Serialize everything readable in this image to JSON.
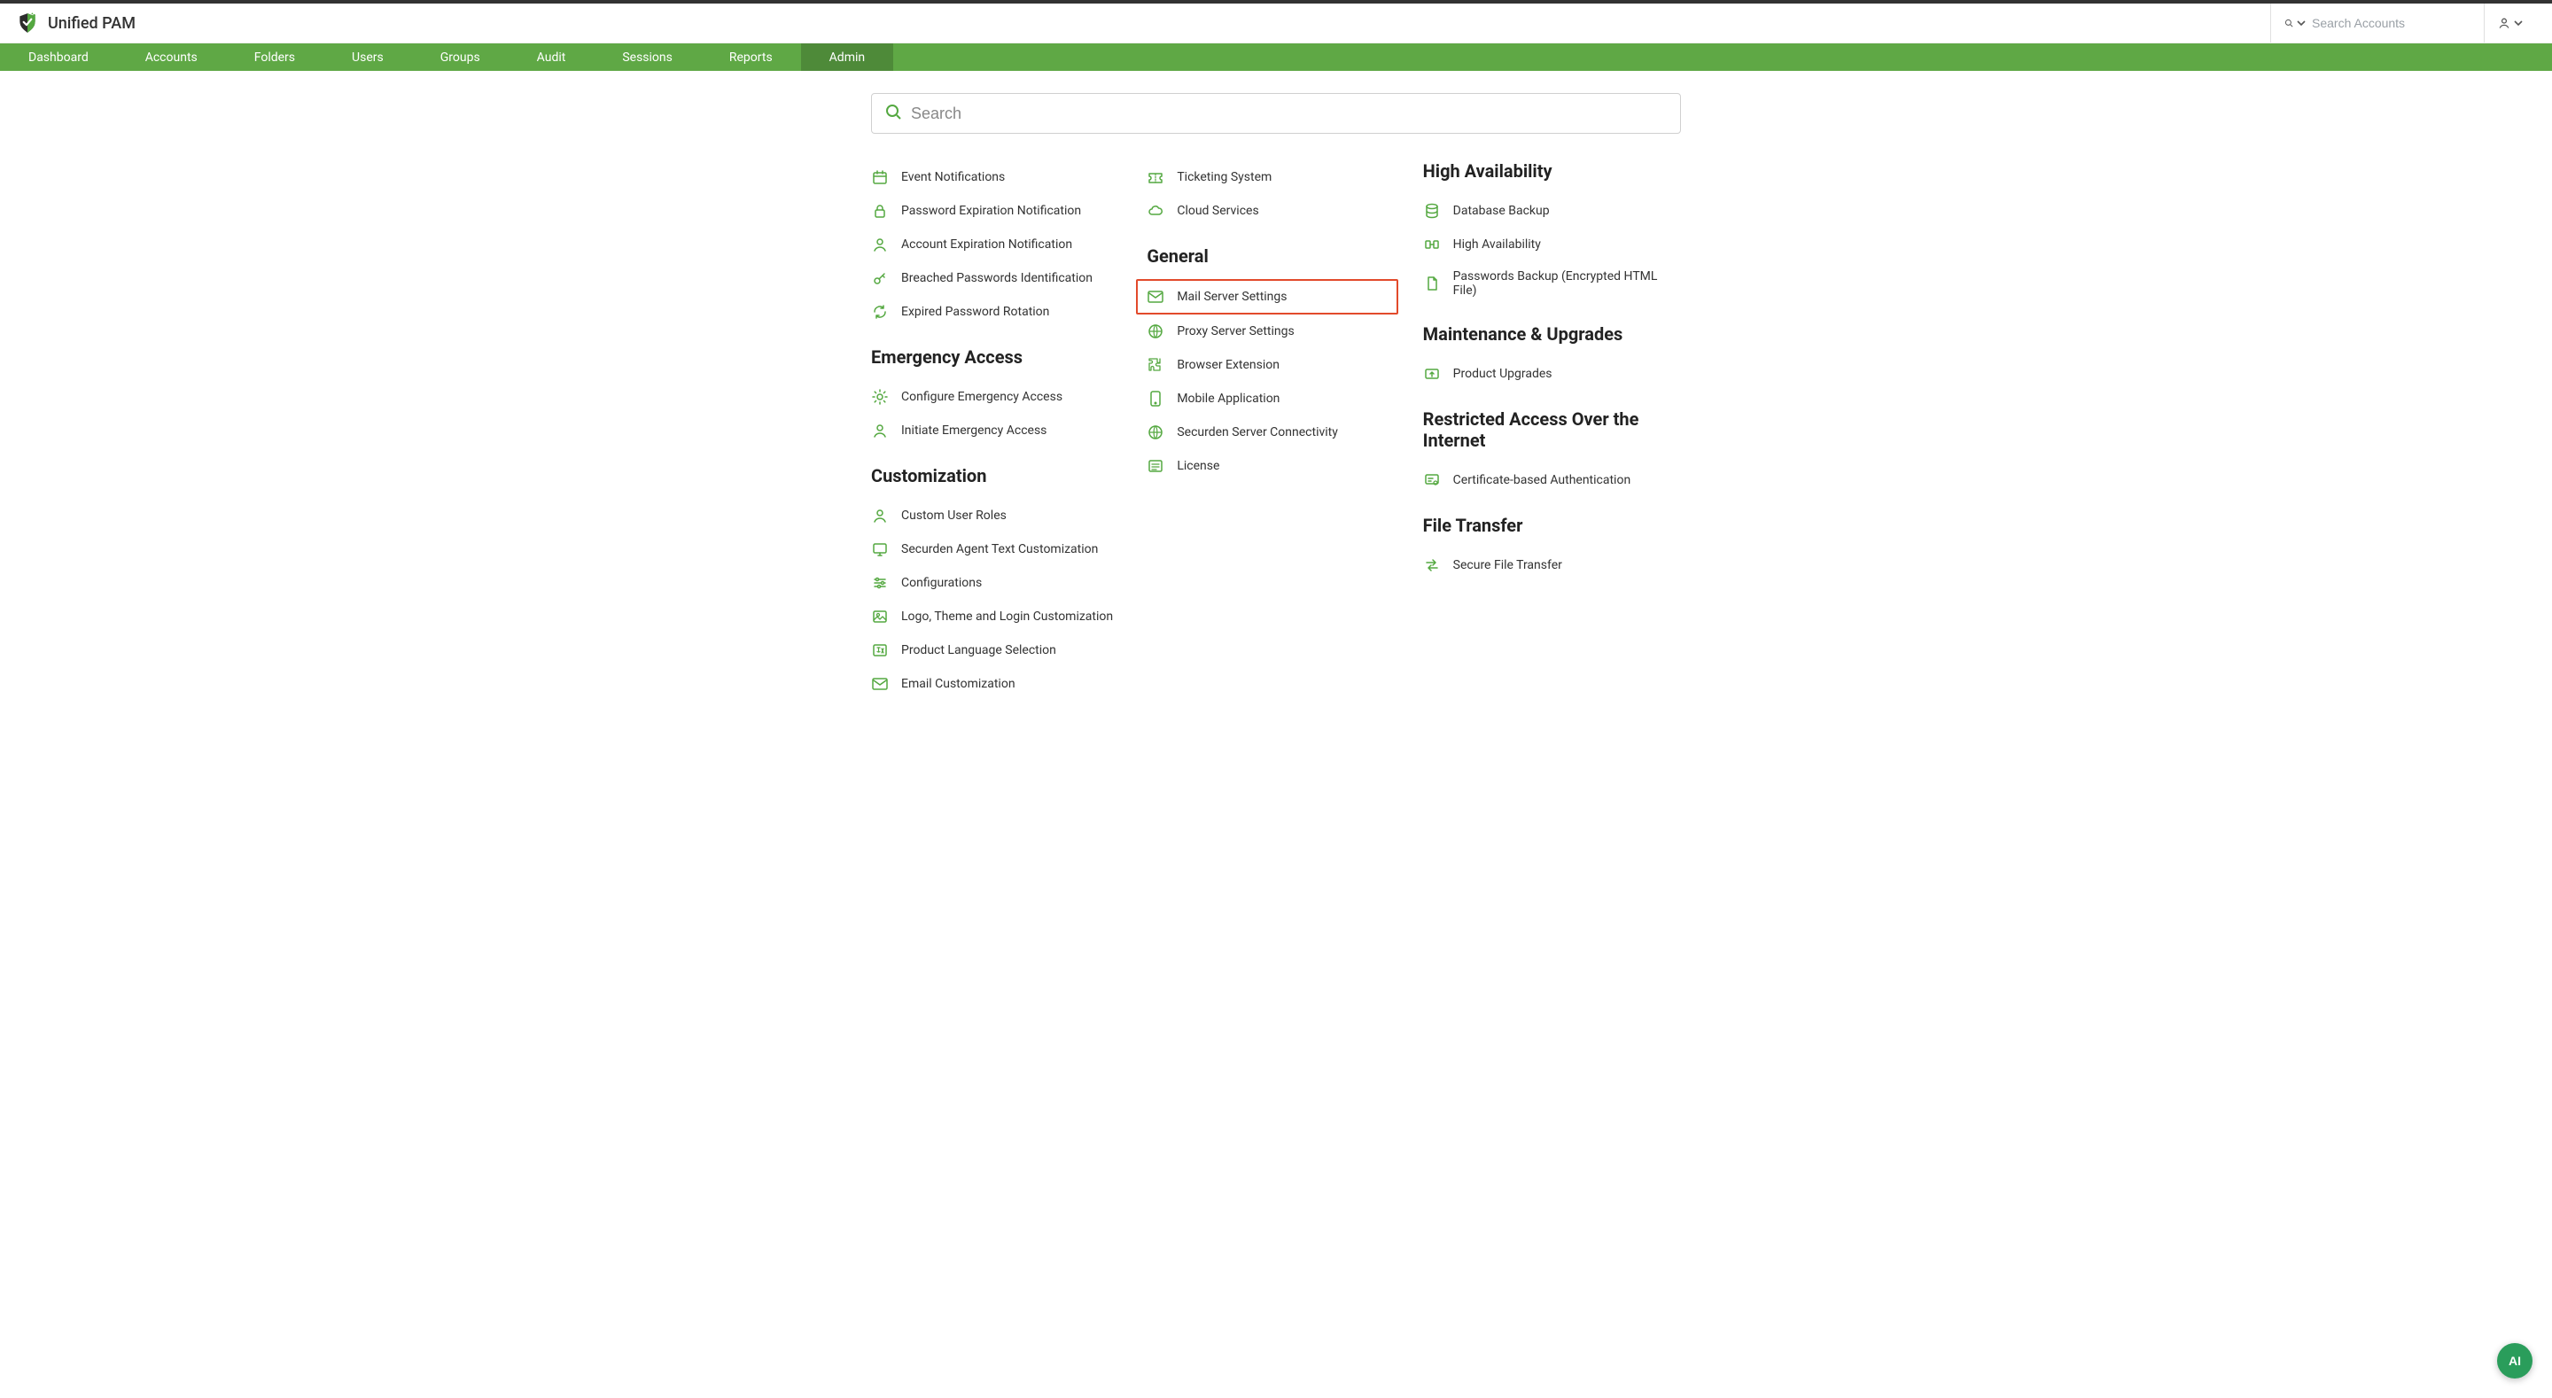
{
  "brand": {
    "name": "Unified PAM"
  },
  "header": {
    "search_placeholder": "Search Accounts"
  },
  "nav": {
    "items": [
      {
        "label": "Dashboard"
      },
      {
        "label": "Accounts"
      },
      {
        "label": "Folders"
      },
      {
        "label": "Users"
      },
      {
        "label": "Groups"
      },
      {
        "label": "Audit"
      },
      {
        "label": "Sessions"
      },
      {
        "label": "Reports"
      },
      {
        "label": "Admin",
        "active": true
      }
    ]
  },
  "admin_search": {
    "placeholder": "Search"
  },
  "columns": [
    {
      "sections": [
        {
          "title": null,
          "items": [
            {
              "icon": "calendar-bell-icon",
              "label": "Event Notifications"
            },
            {
              "icon": "lock-clock-icon",
              "label": "Password Expiration Notification"
            },
            {
              "icon": "person-clock-icon",
              "label": "Account Expiration Notification"
            },
            {
              "icon": "key-alert-icon",
              "label": "Breached Passwords Identification"
            },
            {
              "icon": "refresh-lock-icon",
              "label": "Expired Password Rotation"
            }
          ]
        },
        {
          "title": "Emergency Access",
          "items": [
            {
              "icon": "gear-alert-icon",
              "label": "Configure Emergency Access"
            },
            {
              "icon": "person-run-icon",
              "label": "Initiate Emergency Access"
            }
          ]
        },
        {
          "title": "Customization",
          "items": [
            {
              "icon": "person-gear-icon",
              "label": "Custom User Roles"
            },
            {
              "icon": "screen-gear-icon",
              "label": "Securden Agent Text Customization"
            },
            {
              "icon": "sliders-icon",
              "label": "Configurations"
            },
            {
              "icon": "image-palette-icon",
              "label": "Logo, Theme and Login Customization"
            },
            {
              "icon": "language-icon",
              "label": "Product Language Selection"
            },
            {
              "icon": "mail-edit-icon",
              "label": "Email Customization"
            }
          ]
        }
      ]
    },
    {
      "sections": [
        {
          "title": null,
          "items": [
            {
              "icon": "ticket-icon",
              "label": "Ticketing System"
            },
            {
              "icon": "cloud-icon",
              "label": "Cloud Services"
            }
          ]
        },
        {
          "title": "General",
          "items": [
            {
              "icon": "mail-icon",
              "label": "Mail Server Settings",
              "highlighted": true
            },
            {
              "icon": "globe-icon",
              "label": "Proxy Server Settings"
            },
            {
              "icon": "puzzle-icon",
              "label": "Browser Extension"
            },
            {
              "icon": "mobile-icon",
              "label": "Mobile Application"
            },
            {
              "icon": "globe-link-icon",
              "label": "Securden Server Connectivity"
            },
            {
              "icon": "license-icon",
              "label": "License"
            }
          ]
        }
      ]
    },
    {
      "sections": [
        {
          "title": "High Availability",
          "items": [
            {
              "icon": "database-icon",
              "label": "Database Backup"
            },
            {
              "icon": "ha-icon",
              "label": "High Availability"
            },
            {
              "icon": "file-lock-icon",
              "label": "Passwords Backup (Encrypted HTML File)"
            }
          ]
        },
        {
          "title": "Maintenance & Upgrades",
          "items": [
            {
              "icon": "upgrade-icon",
              "label": "Product Upgrades"
            }
          ]
        },
        {
          "title": "Restricted Access Over the Internet",
          "items": [
            {
              "icon": "certificate-icon",
              "label": "Certificate-based Authentication"
            }
          ]
        },
        {
          "title": "File Transfer",
          "items": [
            {
              "icon": "file-transfer-icon",
              "label": "Secure File Transfer"
            }
          ]
        }
      ]
    }
  ],
  "ai_fab": {
    "label": "AI"
  }
}
